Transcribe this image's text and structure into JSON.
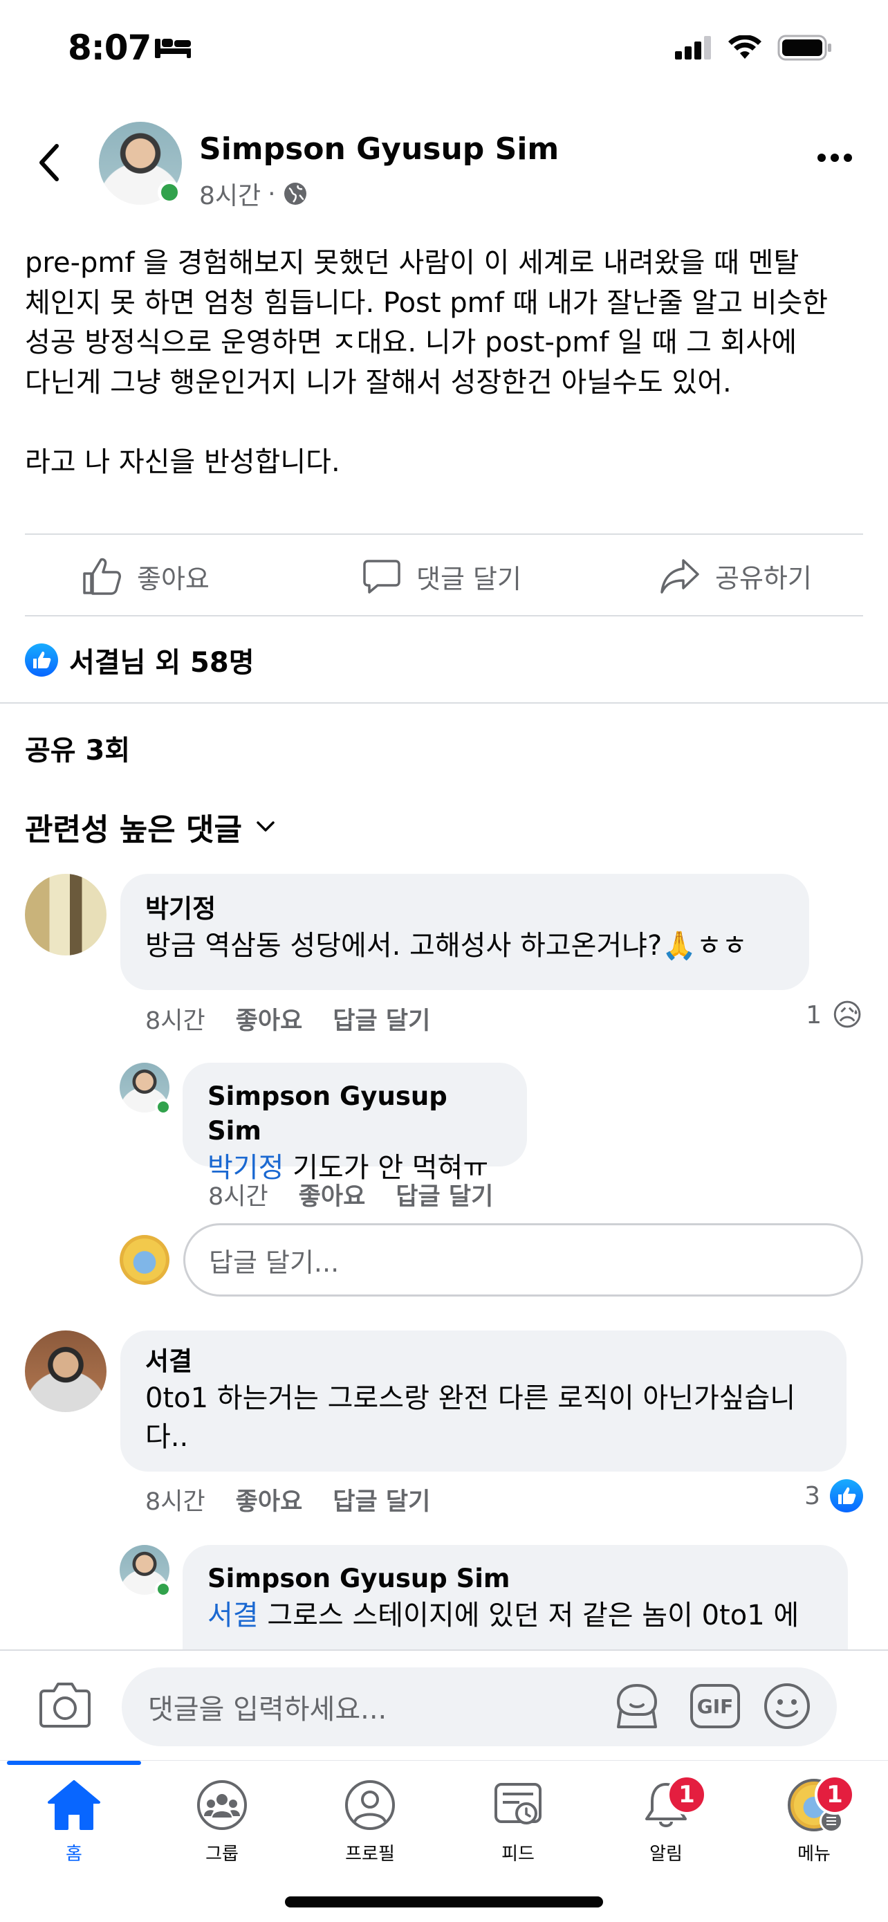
{
  "status_bar": {
    "time": "8:07"
  },
  "post": {
    "author": "Simpson Gyusup Sim",
    "time": "8시간",
    "dot": "·",
    "body": "pre-pmf 을 경험해보지 못했던 사람이 이 세계로 내려왔을 때 멘탈\n체인지 못 하면 엄청 힘듭니다. Post pmf 때 내가 잘난줄 알고 비슷한\n성공 방정식으로 운영하면 ㅈ대요. 니가 post-pmf 일 때 그 회사에\n다닌게 그냥 행운인거지 니가 잘해서 성장한건 아닐수도 있어.\n\n라고 나 자신을 반성합니다."
  },
  "actions": {
    "like": "좋아요",
    "comment": "댓글 달기",
    "share": "공유하기"
  },
  "reactions_summary": "서결님 외 58명",
  "shares": "공유 3회",
  "sort_label": "관련성 높은 댓글",
  "comments": [
    {
      "name": "박기정",
      "text": "방금 역삼동 성당에서. 고해성사 하고온거냐?🙏ㅎㅎ",
      "time": "8시간",
      "like": "좋아요",
      "reply": "답글 달기",
      "reaction_count": "1",
      "reaction_emoji": "😥",
      "replies": [
        {
          "name": "Simpson Gyusup Sim",
          "mention": "박기정",
          "text": " 기도가 안 먹혀ㅠ",
          "time": "8시간",
          "like": "좋아요",
          "reply": "답글 달기"
        }
      ],
      "reply_placeholder": "답글 달기..."
    },
    {
      "name": "서결",
      "text": "0to1 하는거는 그로스랑 완전 다른 로직이 아닌가싶습니\n다..",
      "time": "8시간",
      "like": "좋아요",
      "reply": "답글 달기",
      "reaction_count": "3",
      "replies": [
        {
          "name": "Simpson Gyusup Sim",
          "mention": "서결",
          "text": " 그로스 스테이지에 있던 저 같은 놈이 0to1 에"
        }
      ]
    }
  ],
  "composer": {
    "placeholder": "댓글을 입력하세요...",
    "gif": "GIF"
  },
  "tabs": [
    {
      "label": "홈",
      "icon": "home-icon",
      "active": true
    },
    {
      "label": "그룹",
      "icon": "groups-icon"
    },
    {
      "label": "프로필",
      "icon": "profile-icon"
    },
    {
      "label": "피드",
      "icon": "feeds-icon"
    },
    {
      "label": "알림",
      "icon": "bell-icon",
      "badge": "1"
    },
    {
      "label": "메뉴",
      "icon": "menu-avatar-icon",
      "badge": "1"
    }
  ],
  "colors": {
    "accent": "#0866ff",
    "mention": "#1a68d1",
    "online": "#31a24c",
    "badge": "#e41e3f",
    "bubble": "#f0f2f5"
  }
}
